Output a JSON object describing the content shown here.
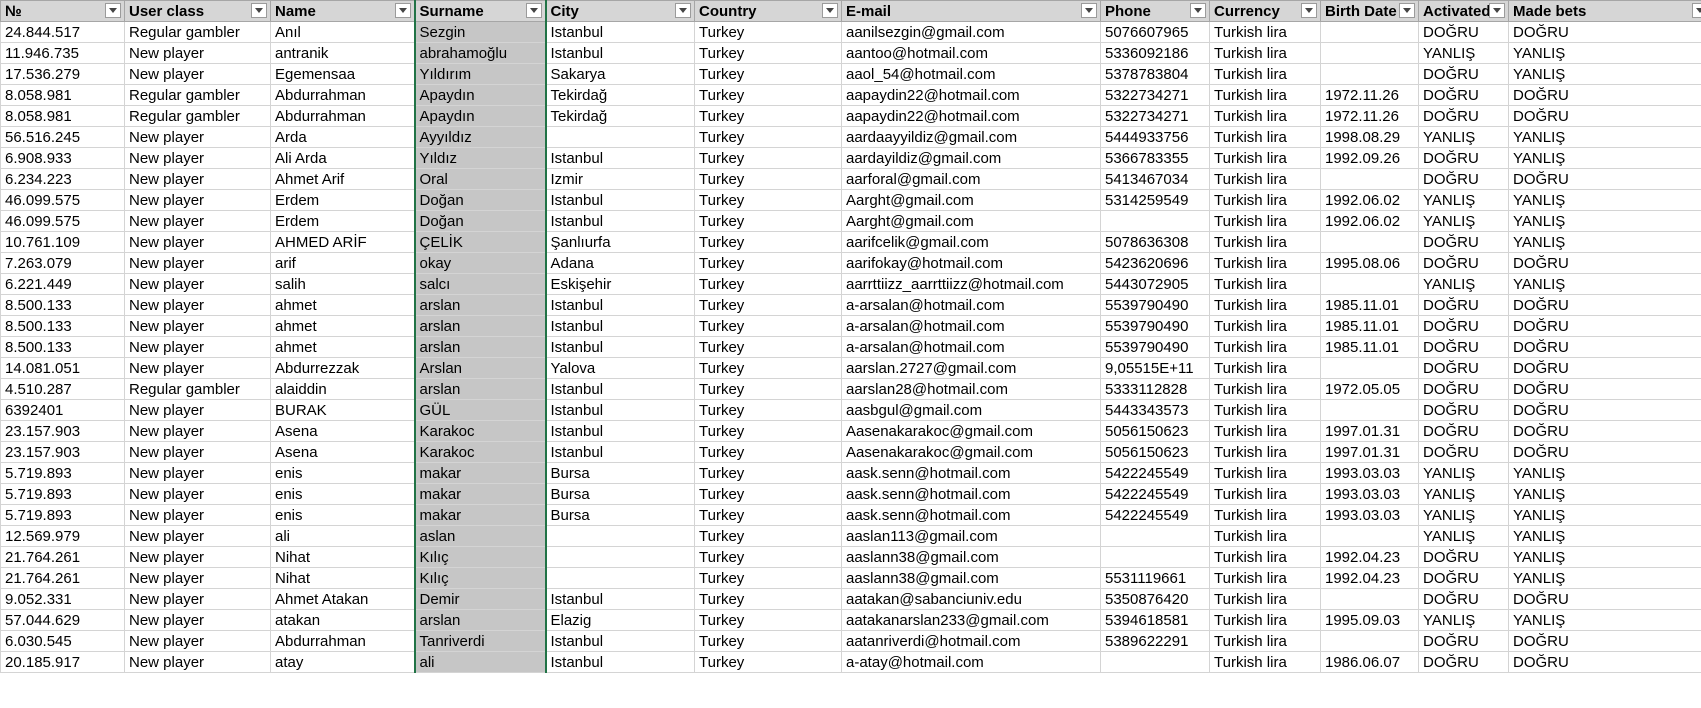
{
  "columns": [
    {
      "key": "no",
      "label": "№"
    },
    {
      "key": "user_class",
      "label": "User class"
    },
    {
      "key": "name",
      "label": "Name"
    },
    {
      "key": "surname",
      "label": "Surname"
    },
    {
      "key": "city",
      "label": "City"
    },
    {
      "key": "country",
      "label": "Country"
    },
    {
      "key": "email",
      "label": "E-mail"
    },
    {
      "key": "phone",
      "label": "Phone"
    },
    {
      "key": "currency",
      "label": "Currency"
    },
    {
      "key": "birth_date",
      "label": "Birth Date"
    },
    {
      "key": "activated",
      "label": "Activated"
    },
    {
      "key": "made_bets",
      "label": "Made bets"
    }
  ],
  "selected_column": "surname",
  "rows": [
    [
      "24.844.517",
      "Regular gambler",
      "Anıl",
      "Sezgin",
      "Istanbul",
      "Turkey",
      "aanilsezgin@gmail.com",
      "5076607965",
      "Turkish lira",
      "",
      "DOĞRU",
      "DOĞRU"
    ],
    [
      "11.946.735",
      "New player",
      "antranik",
      "abrahamoğlu",
      "Istanbul",
      "Turkey",
      "aantoo@hotmail.com",
      "5336092186",
      "Turkish lira",
      "",
      "YANLIŞ",
      "YANLIŞ"
    ],
    [
      "17.536.279",
      "New player",
      "Egemensaa",
      "Yıldırım",
      "Sakarya",
      "Turkey",
      "aaol_54@hotmail.com",
      "5378783804",
      "Turkish lira",
      "",
      "DOĞRU",
      "YANLIŞ"
    ],
    [
      "8.058.981",
      "Regular gambler",
      "Abdurrahman",
      "Apaydın",
      "Tekirdağ",
      "Turkey",
      "aapaydin22@hotmail.com",
      "5322734271",
      "Turkish lira",
      "1972.11.26",
      "DOĞRU",
      "DOĞRU"
    ],
    [
      "8.058.981",
      "Regular gambler",
      "Abdurrahman",
      "Apaydın",
      "Tekirdağ",
      "Turkey",
      "aapaydin22@hotmail.com",
      "5322734271",
      "Turkish lira",
      "1972.11.26",
      "DOĞRU",
      "DOĞRU"
    ],
    [
      "56.516.245",
      "New player",
      "Arda",
      "Ayyıldız",
      "",
      "Turkey",
      "aardaayyildiz@gmail.com",
      "5444933756",
      "Turkish lira",
      "1998.08.29",
      "YANLIŞ",
      "YANLIŞ"
    ],
    [
      "6.908.933",
      "New player",
      "Ali Arda",
      "Yıldız",
      "Istanbul",
      "Turkey",
      "aardayildiz@gmail.com",
      "5366783355",
      "Turkish lira",
      "1992.09.26",
      "DOĞRU",
      "YANLIŞ"
    ],
    [
      "6.234.223",
      "New player",
      "Ahmet Arif",
      "Oral",
      "Izmir",
      "Turkey",
      "aarforal@gmail.com",
      "5413467034",
      "Turkish lira",
      "",
      "DOĞRU",
      "DOĞRU"
    ],
    [
      "46.099.575",
      "New player",
      "Erdem",
      "Doğan",
      "Istanbul",
      "Turkey",
      "Aarght@gmail.com",
      "5314259549",
      "Turkish lira",
      "1992.06.02",
      "YANLIŞ",
      "YANLIŞ"
    ],
    [
      "46.099.575",
      "New player",
      "Erdem",
      "Doğan",
      "Istanbul",
      "Turkey",
      "Aarght@gmail.com",
      "",
      "Turkish lira",
      "1992.06.02",
      "YANLIŞ",
      "YANLIŞ"
    ],
    [
      "10.761.109",
      "New player",
      "AHMED ARİF",
      "ÇELİK",
      "Şanlıurfa",
      "Turkey",
      "aarifcelik@gmail.com",
      "5078636308",
      "Turkish lira",
      "",
      "DOĞRU",
      "YANLIŞ"
    ],
    [
      "7.263.079",
      "New player",
      "arif",
      "okay",
      "Adana",
      "Turkey",
      "aarifokay@hotmail.com",
      "5423620696",
      "Turkish lira",
      "1995.08.06",
      "DOĞRU",
      "DOĞRU"
    ],
    [
      "6.221.449",
      "New player",
      "salih",
      "salcı",
      "Eskişehir",
      "Turkey",
      "aarrttiizz_aarrttiizz@hotmail.com",
      "5443072905",
      "Turkish lira",
      "",
      "YANLIŞ",
      "YANLIŞ"
    ],
    [
      "8.500.133",
      "New player",
      "ahmet",
      "arslan",
      "Istanbul",
      "Turkey",
      "a-arsalan@hotmail.com",
      "5539790490",
      "Turkish lira",
      "1985.11.01",
      "DOĞRU",
      "DOĞRU"
    ],
    [
      "8.500.133",
      "New player",
      "ahmet",
      "arslan",
      "Istanbul",
      "Turkey",
      "a-arsalan@hotmail.com",
      "5539790490",
      "Turkish lira",
      "1985.11.01",
      "DOĞRU",
      "DOĞRU"
    ],
    [
      "8.500.133",
      "New player",
      "ahmet",
      "arslan",
      "Istanbul",
      "Turkey",
      "a-arsalan@hotmail.com",
      "5539790490",
      "Turkish lira",
      "1985.11.01",
      "DOĞRU",
      "DOĞRU"
    ],
    [
      "14.081.051",
      "New player",
      "Abdurrezzak",
      "Arslan",
      "Yalova",
      "Turkey",
      "aarslan.2727@gmail.com",
      "9,05515E+11",
      "Turkish lira",
      "",
      "DOĞRU",
      "DOĞRU"
    ],
    [
      "4.510.287",
      "Regular gambler",
      "alaiddin",
      "arslan",
      "Istanbul",
      "Turkey",
      "aarslan28@hotmail.com",
      "5333112828",
      "Turkish lira",
      "1972.05.05",
      "DOĞRU",
      "DOĞRU"
    ],
    [
      "6392401",
      "New player",
      "BURAK",
      "GÜL",
      "Istanbul",
      "Turkey",
      "aasbgul@gmail.com",
      "5443343573",
      "Turkish lira",
      "",
      "DOĞRU",
      "DOĞRU"
    ],
    [
      "23.157.903",
      "New player",
      "Asena",
      "Karakoc",
      "Istanbul",
      "Turkey",
      "Aasenakarakoc@gmail.com",
      "5056150623",
      "Turkish lira",
      "1997.01.31",
      "DOĞRU",
      "DOĞRU"
    ],
    [
      "23.157.903",
      "New player",
      "Asena",
      "Karakoc",
      "Istanbul",
      "Turkey",
      "Aasenakarakoc@gmail.com",
      "5056150623",
      "Turkish lira",
      "1997.01.31",
      "DOĞRU",
      "DOĞRU"
    ],
    [
      "5.719.893",
      "New player",
      "enis",
      "makar",
      "Bursa",
      "Turkey",
      "aask.senn@hotmail.com",
      "5422245549",
      "Turkish lira",
      "1993.03.03",
      "YANLIŞ",
      "YANLIŞ"
    ],
    [
      "5.719.893",
      "New player",
      "enis",
      "makar",
      "Bursa",
      "Turkey",
      "aask.senn@hotmail.com",
      "5422245549",
      "Turkish lira",
      "1993.03.03",
      "YANLIŞ",
      "YANLIŞ"
    ],
    [
      "5.719.893",
      "New player",
      "enis",
      "makar",
      "Bursa",
      "Turkey",
      "aask.senn@hotmail.com",
      "5422245549",
      "Turkish lira",
      "1993.03.03",
      "YANLIŞ",
      "YANLIŞ"
    ],
    [
      "12.569.979",
      "New player",
      "ali",
      "aslan",
      "",
      "Turkey",
      "aaslan113@gmail.com",
      "",
      "Turkish lira",
      "",
      "YANLIŞ",
      "YANLIŞ"
    ],
    [
      "21.764.261",
      "New player",
      "Nihat",
      "Kılıç",
      "",
      "Turkey",
      "aaslann38@gmail.com",
      "",
      "Turkish lira",
      "1992.04.23",
      "DOĞRU",
      "YANLIŞ"
    ],
    [
      "21.764.261",
      "New player",
      "Nihat",
      "Kılıç",
      "",
      "Turkey",
      "aaslann38@gmail.com",
      "5531119661",
      "Turkish lira",
      "1992.04.23",
      "DOĞRU",
      "YANLIŞ"
    ],
    [
      "9.052.331",
      "New player",
      "Ahmet  Atakan",
      "Demir",
      "Istanbul",
      "Turkey",
      "aatakan@sabanciuniv.edu",
      "5350876420",
      "Turkish lira",
      "",
      "DOĞRU",
      "DOĞRU"
    ],
    [
      "57.044.629",
      "New player",
      "atakan",
      "arslan",
      "Elazig",
      "Turkey",
      "aatakanarslan233@gmail.com",
      "5394618581",
      "Turkish lira",
      "1995.09.03",
      "YANLIŞ",
      "YANLIŞ"
    ],
    [
      "6.030.545",
      "New player",
      "Abdurrahman",
      "Tanriverdi",
      "Istanbul",
      "Turkey",
      "aatanriverdi@hotmail.com",
      "5389622291",
      "Turkish lira",
      "",
      "DOĞRU",
      "DOĞRU"
    ],
    [
      "20.185.917",
      "New player",
      "atay",
      "ali",
      "Istanbul",
      "Turkey",
      "a-atay@hotmail.com",
      "",
      "Turkish lira",
      "1986.06.07",
      "DOĞRU",
      "DOĞRU"
    ]
  ],
  "icons": {
    "filter": "dropdown-filter-icon"
  }
}
